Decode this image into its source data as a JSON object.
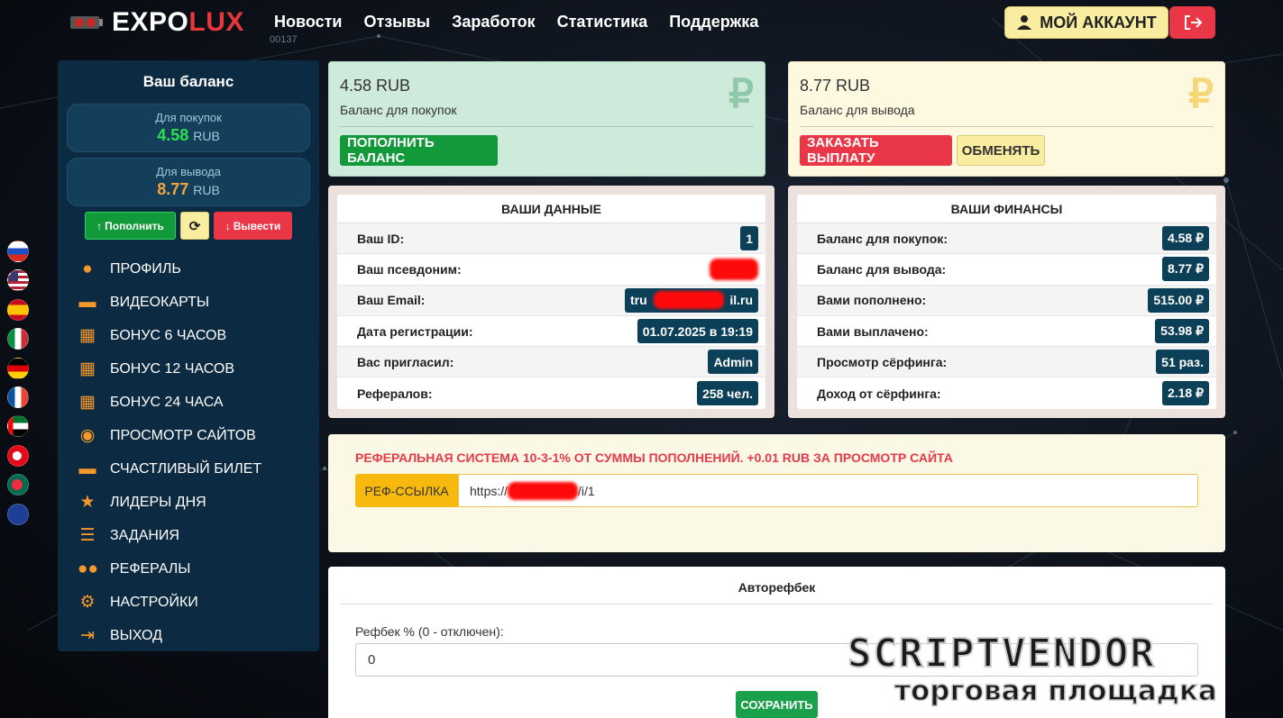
{
  "header": {
    "logo_main": "EXPO",
    "logo_accent": "LUX",
    "online_counter": "00137",
    "nav": [
      "Новости",
      "Отзывы",
      "Заработок",
      "Статистика",
      "Поддержка"
    ],
    "account_button": "МОЙ АККАУНТ"
  },
  "sidebar": {
    "title": "Ваш баланс",
    "purchase_label": "Для покупок",
    "purchase_value": "4.58",
    "withdraw_label": "Для вывода",
    "withdraw_value": "8.77",
    "currency": "RUB",
    "btn_topup": "Пополнить",
    "btn_withdraw": "Вывести",
    "menu": [
      {
        "label": "ПРОФИЛЬ",
        "icon": "user-icon"
      },
      {
        "label": "ВИДЕОКАРТЫ",
        "icon": "card-icon"
      },
      {
        "label": "БОНУС 6 ЧАСОВ",
        "icon": "gift-icon"
      },
      {
        "label": "БОНУС 12 ЧАСОВ",
        "icon": "gift-icon"
      },
      {
        "label": "БОНУС 24 ЧАСА",
        "icon": "gift-icon"
      },
      {
        "label": "ПРОСМОТР САЙТОВ",
        "icon": "eye-icon"
      },
      {
        "label": "СЧАСТЛИВЫЙ БИЛЕТ",
        "icon": "ticket-icon"
      },
      {
        "label": "ЛИДЕРЫ ДНЯ",
        "icon": "star-icon"
      },
      {
        "label": "ЗАДАНИЯ",
        "icon": "tasks-icon"
      },
      {
        "label": "РЕФЕРАЛЫ",
        "icon": "users-icon"
      },
      {
        "label": "НАСТРОЙКИ",
        "icon": "gear-icon"
      },
      {
        "label": "ВЫХОД",
        "icon": "logout-icon"
      }
    ]
  },
  "flags": [
    "ru",
    "us",
    "es",
    "it",
    "de",
    "fr",
    "ae",
    "tr",
    "bd",
    "fk"
  ],
  "balance_purchase": {
    "amount": "4.58 RUB",
    "label": "Баланс для покупок",
    "button": "ПОПОЛНИТЬ БАЛАНС"
  },
  "balance_withdraw": {
    "amount": "8.77 RUB",
    "label": "Баланс для вывода",
    "button_payout": "ЗАКАЗАТЬ ВЫПЛАТУ",
    "button_exchange": "ОБМЕНЯТЬ"
  },
  "ruble_sign": "₽",
  "your_data": {
    "title": "ВАШИ ДАННЫЕ",
    "rows": [
      {
        "label": "Ваш ID:",
        "value": "1"
      },
      {
        "label": "Ваш псевдоним:",
        "value": ""
      },
      {
        "label": "Ваш Email:",
        "value_start": "tru",
        "value_end": "il.ru"
      },
      {
        "label": "Дата регистрации:",
        "value": "01.07.2025 в 19:19"
      },
      {
        "label": "Вас пригласил:",
        "value": "Admin"
      },
      {
        "label": "Рефералов:",
        "value": "258 чел."
      }
    ]
  },
  "your_finance": {
    "title": "ВАШИ ФИНАНСЫ",
    "rows": [
      {
        "label": "Баланс для покупок:",
        "value": "4.58 ₽"
      },
      {
        "label": "Баланс для вывода:",
        "value": "8.77 ₽"
      },
      {
        "label": "Вами пополнено:",
        "value": "515.00 ₽"
      },
      {
        "label": "Вами выплачено:",
        "value": "53.98 ₽"
      },
      {
        "label": "Просмотр сёрфинга:",
        "value": "51 раз."
      },
      {
        "label": "Доход от сёрфинга:",
        "value": "2.18 ₽"
      }
    ]
  },
  "referral": {
    "title": "РЕФЕРАЛЬНАЯ СИСТЕМА 10-3-1% ОТ СУММЫ ПОПОЛНЕНИЙ. +0.01 RUB ЗА ПРОСМОТР САЙТА",
    "link_label": "РЕФ-ССЫЛКА",
    "link_start": "https://",
    "link_end": "/i/1"
  },
  "autoref": {
    "title": "Авторефбек",
    "field_label": "Рефбек % (0 - отключен):",
    "field_value": "0",
    "save_button": "СОХРАНИТЬ"
  },
  "watermark": {
    "line1": "SCRIPTVENDOR",
    "line2": "торговая площадка"
  }
}
